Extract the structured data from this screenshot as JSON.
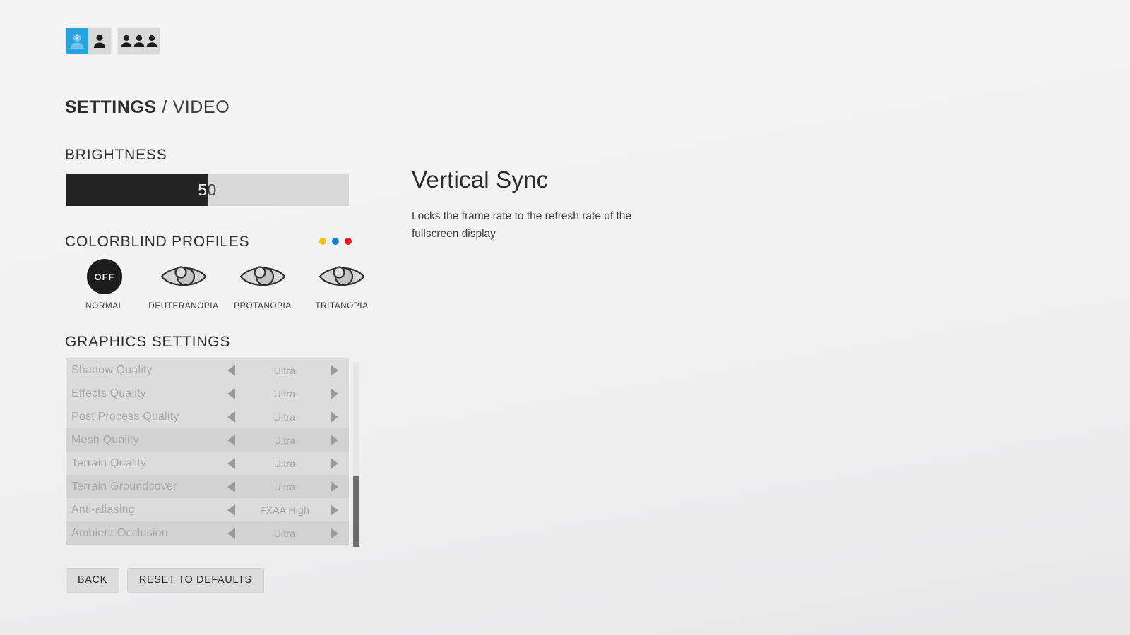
{
  "topbar": {
    "tabs": [
      {
        "name": "player-unknown-icon",
        "icon": "person-question-icon",
        "active": true
      },
      {
        "name": "player-icon",
        "icon": "person-icon",
        "active": false
      }
    ],
    "group_tab": {
      "name": "party-icon",
      "icon": "people-group-icon",
      "active": false
    }
  },
  "header": {
    "title_strong": "SETTINGS",
    "title_separator": " / ",
    "title_light": "VIDEO"
  },
  "brightness": {
    "heading": "BRIGHTNESS",
    "value": "50",
    "percent": 50
  },
  "colorblind": {
    "heading": "COLORBLIND PROFILES",
    "dots": [
      {
        "name": "dot-yellow",
        "color": "#f2c21b"
      },
      {
        "name": "dot-blue",
        "color": "#1a7fd0"
      },
      {
        "name": "dot-red",
        "color": "#e01f1f"
      }
    ],
    "profiles": [
      {
        "label": "NORMAL",
        "badge": "OFF",
        "selected": true
      },
      {
        "label": "DEUTERANOPIA",
        "badge": "",
        "selected": false
      },
      {
        "label": "PROTANOPIA",
        "badge": "",
        "selected": false
      },
      {
        "label": "TRITANOPIA",
        "badge": "",
        "selected": false
      }
    ]
  },
  "graphics": {
    "heading": "GRAPHICS SETTINGS",
    "rows": [
      {
        "name": "Shadow Quality",
        "value": "Ultra"
      },
      {
        "name": "Effects Quality",
        "value": "Ultra"
      },
      {
        "name": "Post Process Quality",
        "value": "Ultra"
      },
      {
        "name": "Mesh Quality",
        "value": "Ultra"
      },
      {
        "name": "Terrain Quality",
        "value": "Ultra"
      },
      {
        "name": "Terrain Groundcover",
        "value": "Ultra"
      },
      {
        "name": "Anti-aliasing",
        "value": "FXAA High"
      },
      {
        "name": "Ambient Occlusion",
        "value": "Ultra"
      }
    ],
    "scrollbar": {
      "thumb_top_pct": 62,
      "thumb_height_pct": 38
    }
  },
  "footer": {
    "back_label": "BACK",
    "reset_label": "RESET TO DEFAULTS"
  },
  "detail": {
    "title": "Vertical Sync",
    "description": "Locks the frame rate to the refresh rate of the fullscreen display"
  }
}
